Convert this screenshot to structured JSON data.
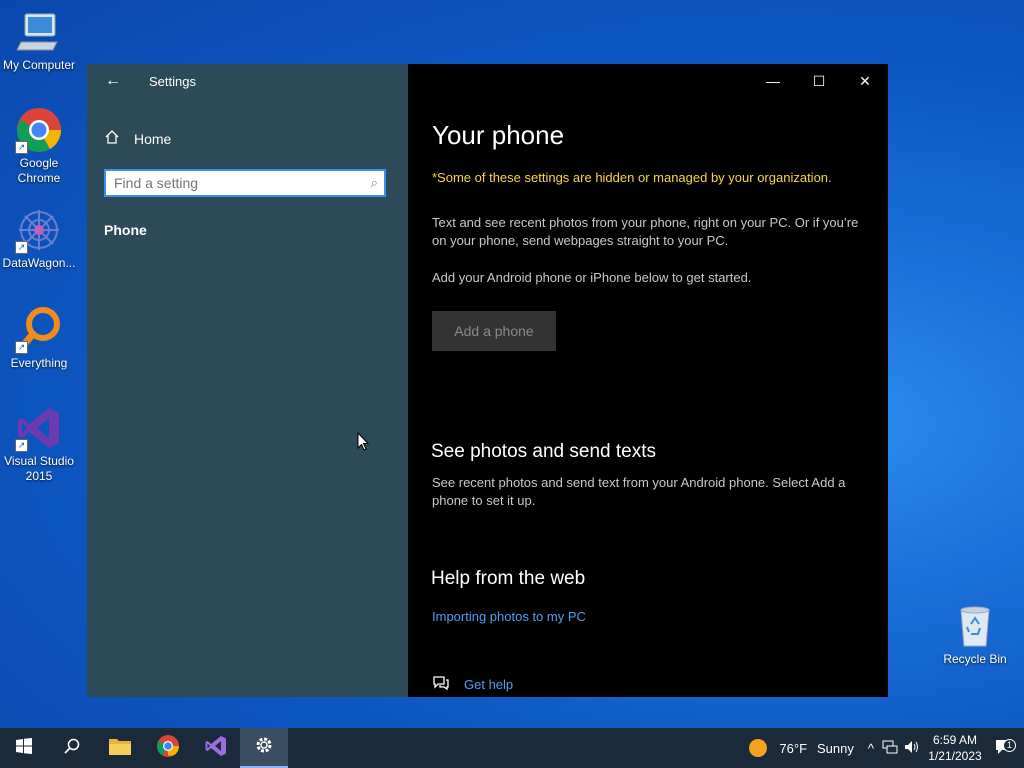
{
  "desktop": {
    "icons": [
      {
        "label": "My Computer"
      },
      {
        "label": "Google Chrome"
      },
      {
        "label": "DataWagon..."
      },
      {
        "label": "Everything"
      },
      {
        "label": "Visual Studio 2015"
      },
      {
        "label": "Recycle Bin"
      }
    ]
  },
  "window": {
    "app_title": "Settings",
    "nav": {
      "home_label": "Home",
      "search_placeholder": "Find a setting",
      "current_section": "Phone"
    },
    "controls": {
      "minimize": "—",
      "maximize": "☐",
      "close": "✕"
    },
    "content": {
      "title": "Your phone",
      "managed_warning": "*Some of these settings are hidden or managed by your organization.",
      "description": "Text and see recent photos from your phone, right on your PC. Or if you’re on your phone, send webpages straight to your PC.",
      "get_started": "Add your Android phone or iPhone below to get started.",
      "add_phone_button": "Add a phone",
      "section1_title": "See photos and send texts",
      "section1_text": "See recent photos and send text from your Android phone. Select Add a phone to set it up.",
      "section2_title": "Help from the web",
      "help_link": "Importing photos to my PC",
      "get_help": "Get help"
    }
  },
  "taskbar": {
    "weather_temp": "76°F",
    "weather_desc": "Sunny",
    "time": "6:59 AM",
    "date": "1/21/2023",
    "notification_count": "1"
  },
  "colors": {
    "nav_bg": "#2c4a57",
    "content_bg": "#000000",
    "warning": "#f5d547",
    "link": "#4aa0f0",
    "taskbar_bg": "#1b2a3a"
  }
}
